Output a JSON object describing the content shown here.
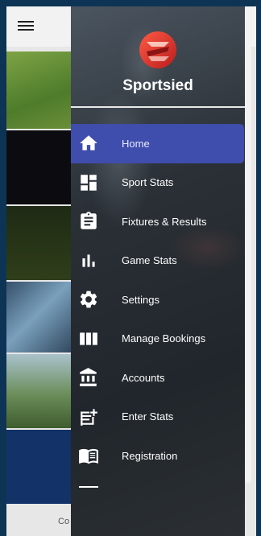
{
  "app": {
    "footer_text": "Co"
  },
  "drawer": {
    "brand": "Sportsied",
    "items": [
      {
        "label": "Home",
        "icon": "home-icon",
        "active": true
      },
      {
        "label": "Sport Stats",
        "icon": "dashboard-icon",
        "active": false
      },
      {
        "label": "Fixtures & Results",
        "icon": "clipboard-icon",
        "active": false
      },
      {
        "label": "Game Stats",
        "icon": "bar-chart-icon",
        "active": false
      },
      {
        "label": "Settings",
        "icon": "gear-icon",
        "active": false
      },
      {
        "label": "Manage Bookings",
        "icon": "columns-icon",
        "active": false
      },
      {
        "label": "Accounts",
        "icon": "bank-icon",
        "active": false
      },
      {
        "label": "Enter Stats",
        "icon": "note-add-icon",
        "active": false
      },
      {
        "label": "Registration",
        "icon": "book-icon",
        "active": false
      }
    ]
  },
  "colors": {
    "active_item": "#3f4dac",
    "logo_red": "#d9302c",
    "frame_blue": "#0d3454"
  }
}
